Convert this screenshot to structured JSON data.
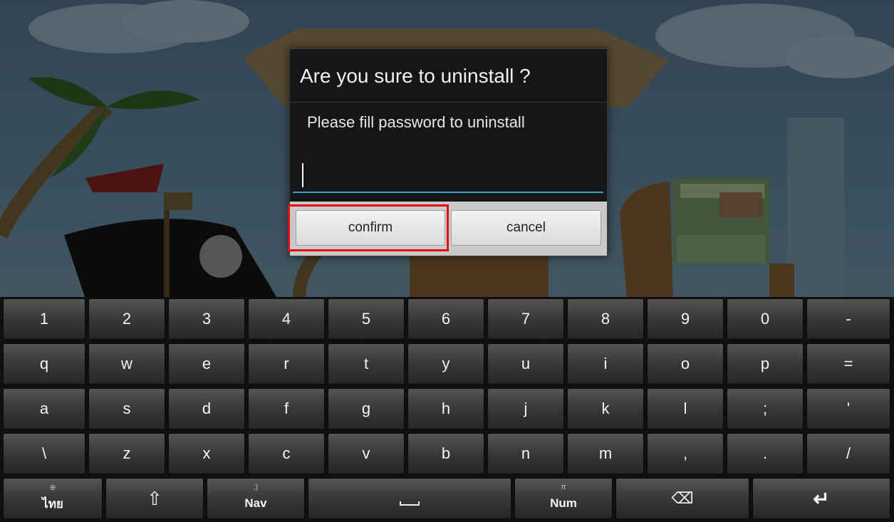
{
  "dialog": {
    "title": "Are you sure to uninstall ?",
    "message": "Please fill password to uninstall",
    "password_value": "",
    "confirm_label": "confirm",
    "cancel_label": "cancel"
  },
  "keyboard": {
    "row1": [
      "1",
      "2",
      "3",
      "4",
      "5",
      "6",
      "7",
      "8",
      "9",
      "0",
      "-"
    ],
    "row2": [
      "q",
      "w",
      "e",
      "r",
      "t",
      "y",
      "u",
      "i",
      "o",
      "p",
      "="
    ],
    "row3": [
      "a",
      "s",
      "d",
      "f",
      "g",
      "h",
      "j",
      "k",
      "l",
      ";",
      "'"
    ],
    "row4": [
      "\\",
      "z",
      "x",
      "c",
      "v",
      "b",
      "n",
      "m",
      ",",
      ".",
      "/"
    ],
    "bottom": {
      "lang_label": "ไทย",
      "lang_sub": "⊕",
      "shift_icon": "⇧",
      "nav_label": "Nav",
      "nav_sub": ";)",
      "num_label": "Num",
      "num_sub": "π",
      "backspace_icon": "⌫",
      "enter_icon": "↵"
    }
  },
  "colors": {
    "highlight": "#e01010",
    "field_underline": "#35a0c8"
  }
}
